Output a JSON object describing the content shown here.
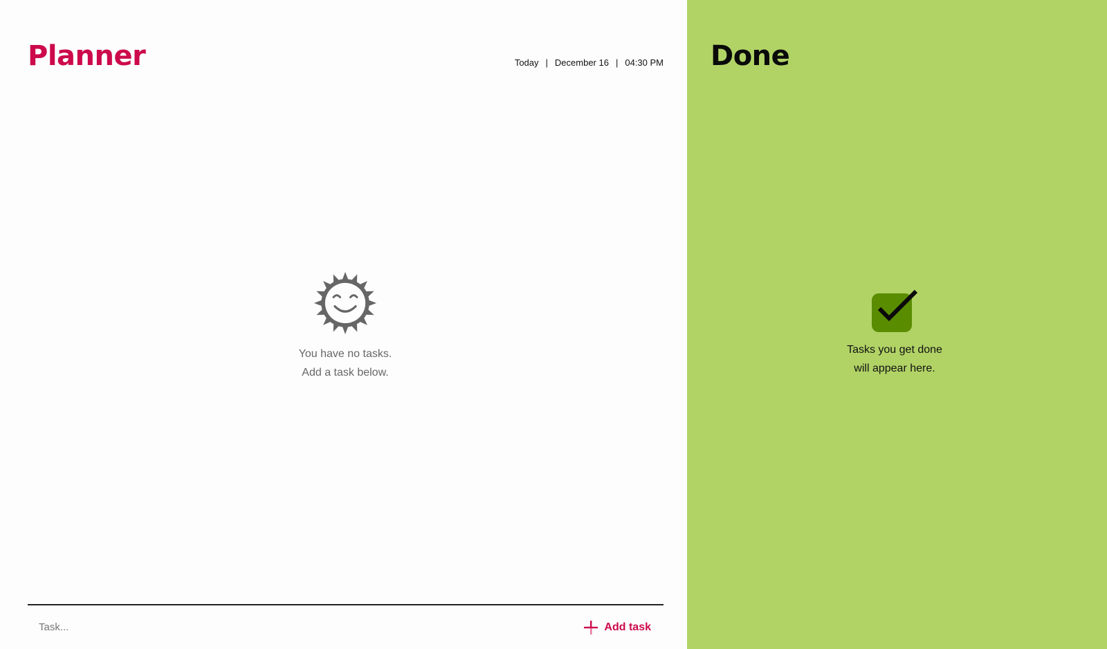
{
  "planner": {
    "title": "Planner",
    "datetime": {
      "day_label": "Today",
      "separator": "|",
      "date": "December 16",
      "time": "04:30 PM"
    },
    "empty_state": {
      "icon": "smiling-sun-icon",
      "line1": "You have no tasks.",
      "line2": "Add a task below."
    },
    "task_input": {
      "value": "",
      "placeholder": "Task..."
    },
    "add_button": {
      "icon": "plus-icon",
      "label": "Add task"
    }
  },
  "done": {
    "title": "Done",
    "empty_state": {
      "icon": "checkbox-check-icon",
      "line1": "Tasks you get done",
      "line2": "will appear here."
    }
  },
  "colors": {
    "brand": "#cc0a4b",
    "done_background": "#b1d366",
    "check_box": "#5a8c00",
    "planner_background": "#fdfdfd",
    "muted_text": "#666666"
  }
}
